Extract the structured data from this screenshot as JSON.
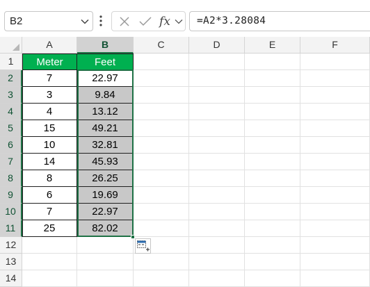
{
  "formula_bar": {
    "name_box": "B2",
    "formula": "=A2*3.28084",
    "fx_label": "fx",
    "icons": [
      "chevron-down-icon",
      "more-options-icon",
      "cancel-icon",
      "enter-icon",
      "insert-function-icon",
      "expand-formula-icon"
    ]
  },
  "grid": {
    "columns": [
      "A",
      "B",
      "C",
      "D",
      "E",
      "F"
    ],
    "rows": [
      "1",
      "2",
      "3",
      "4",
      "5",
      "6",
      "7",
      "8",
      "9",
      "10",
      "11",
      "12",
      "13",
      "14"
    ],
    "table": {
      "headers": [
        "Meter",
        "Feet"
      ],
      "rows": [
        [
          "7",
          "22.97"
        ],
        [
          "3",
          "9.84"
        ],
        [
          "4",
          "13.12"
        ],
        [
          "15",
          "49.21"
        ],
        [
          "10",
          "32.81"
        ],
        [
          "14",
          "45.93"
        ],
        [
          "8",
          "26.25"
        ],
        [
          "6",
          "19.69"
        ],
        [
          "7",
          "22.97"
        ],
        [
          "25",
          "82.02"
        ]
      ]
    },
    "selected_range": "B2:B11",
    "quick_analysis_icon": "quick-analysis-icon"
  },
  "colors": {
    "header_fill": "#00b050",
    "selection_shade": "#c8c8c8",
    "selection_border": "#1e7145"
  }
}
